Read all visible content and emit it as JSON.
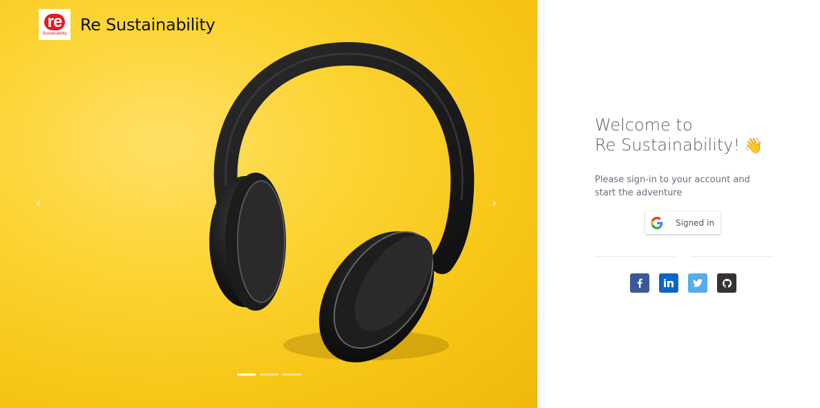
{
  "brand": {
    "logo_text": "re",
    "logo_subtext": "Sustainability",
    "name": "Re Sustainability"
  },
  "carousel": {
    "prev_icon": "chevron-left-icon",
    "next_icon": "chevron-right-icon",
    "prev_glyph": "‹",
    "next_glyph": "›",
    "slides_count": 3,
    "active_slide": 1
  },
  "login": {
    "welcome_line1": "Welcome to",
    "welcome_line2": "Re Sustainability!",
    "wave_emoji": "👋",
    "subtitle": "Please sign-in to your account and start the adventure",
    "google_button_label": "Signed in"
  },
  "socials": [
    {
      "name": "facebook",
      "icon": "facebook-icon",
      "color": "#3b5998"
    },
    {
      "name": "linkedin",
      "icon": "linkedin-icon",
      "color": "#0a66c2"
    },
    {
      "name": "twitter",
      "icon": "twitter-icon",
      "color": "#55acee"
    },
    {
      "name": "github",
      "icon": "github-icon",
      "color": "#333333"
    }
  ],
  "colors": {
    "background_yellow": "#f7c515",
    "brand_red": "#e31b23",
    "heading": "#5d596c",
    "text": "#6f6b7d"
  }
}
